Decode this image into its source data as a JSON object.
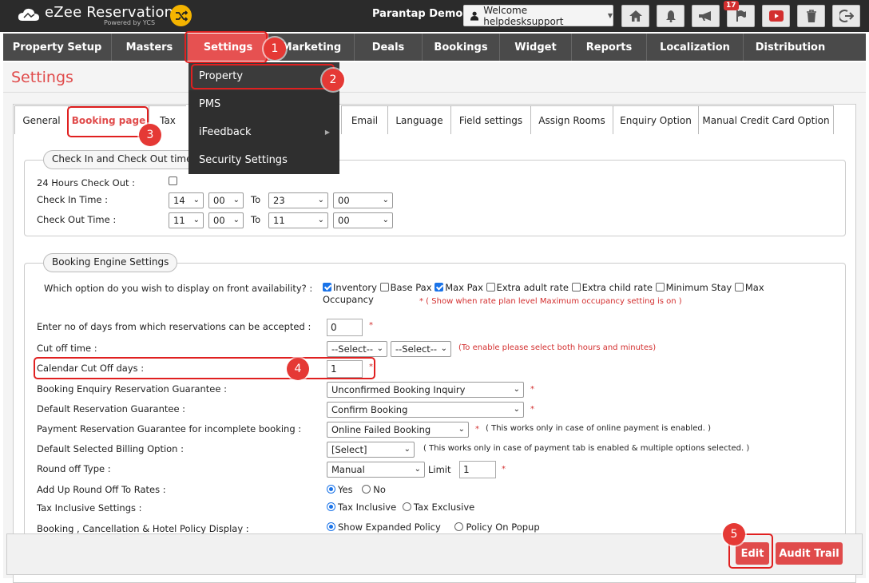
{
  "app": {
    "logo_title": "eZee Reservation",
    "logo_sub": "Powered by YCS",
    "property_name": "Parantap Demo",
    "welcome": "Welcome helpdesksupport",
    "notification_count": "17",
    "icons": [
      "home-icon",
      "bell-icon",
      "megaphone-icon",
      "flag-icon",
      "youtube-icon",
      "trash-icon",
      "logout-icon"
    ]
  },
  "nav": [
    "Property Setup",
    "Masters",
    "Settings",
    "Marketing",
    "Deals",
    "Bookings",
    "Widget",
    "Reports",
    "Localization",
    "Distribution"
  ],
  "page_title": "Settings",
  "settings_menu": [
    "Property",
    "PMS",
    "iFeedback",
    "Security Settings"
  ],
  "tabs": [
    "General",
    "Booking page",
    "Tax",
    "Email",
    "Language",
    "Field settings",
    "Assign Rooms",
    "Enquiry Option",
    "Manual Credit Card Option"
  ],
  "checkin_section": {
    "legend": "Check In and Check Out time se",
    "hours24_label": "24 Hours Check Out :",
    "checkin_label": "Check In Time :",
    "checkout_label": "Check Out Time :",
    "to": "To",
    "checkin": [
      "14",
      "00",
      "23",
      "00"
    ],
    "checkout": [
      "11",
      "00",
      "11",
      "00"
    ]
  },
  "engine": {
    "legend": "Booking Engine Settings",
    "availability_label": "Which option do you wish to display on front availability? :",
    "options": [
      "Inventory",
      "Base Pax",
      "Max Pax",
      "Extra adult rate",
      "Extra child rate",
      "Minimum Stay",
      "Max"
    ],
    "option_wrap": "Occupancy",
    "max_occ_note": "* ( Show when rate plan level Maximum occupancy setting is on )",
    "days_label": "Enter no of days from which reservations can be accepted :",
    "days_value": "0",
    "cutoff_label": "Cut off time :",
    "cutoff_hours": "--Select--",
    "cutoff_minutes": "--Select--",
    "cutoff_note": "(To enable please select both hours and minutes)",
    "calendar_label": "Calendar Cut Off days :",
    "calendar_value": "1",
    "enquiry_label": "Booking Enquiry Reservation Guarantee :",
    "enquiry_value": "Unconfirmed Booking Inquiry",
    "default_res_label": "Default Reservation Guarantee :",
    "default_res_value": "Confirm Booking",
    "payment_label": "Payment Reservation Guarantee for incomplete booking :",
    "payment_value": "Online Failed Booking",
    "payment_note": "( This works only in case of online payment is enabled. )",
    "billing_label": "Default Selected Billing Option :",
    "billing_value": "[Select]",
    "billing_note": "( This works only in case of payment tab is enabled & multiple options selected. )",
    "round_label": "Round off Type :",
    "round_value": "Manual",
    "limit_label": "Limit",
    "limit_value": "1",
    "addup_label": "Add Up Round Off To Rates :",
    "yes": "Yes",
    "no": "No",
    "tax_label": "Tax Inclusive Settings :",
    "tax_inc": "Tax Inclusive",
    "tax_exc": "Tax Exclusive",
    "policy_label": "Booking , Cancellation & Hotel Policy Display :",
    "policy_expanded": "Show Expanded Policy",
    "policy_popup": "Policy On Popup",
    "star": "*"
  },
  "actions": {
    "edit": "Edit",
    "audit": "Audit Trail"
  },
  "markers": [
    "1",
    "2",
    "3",
    "4",
    "5"
  ]
}
